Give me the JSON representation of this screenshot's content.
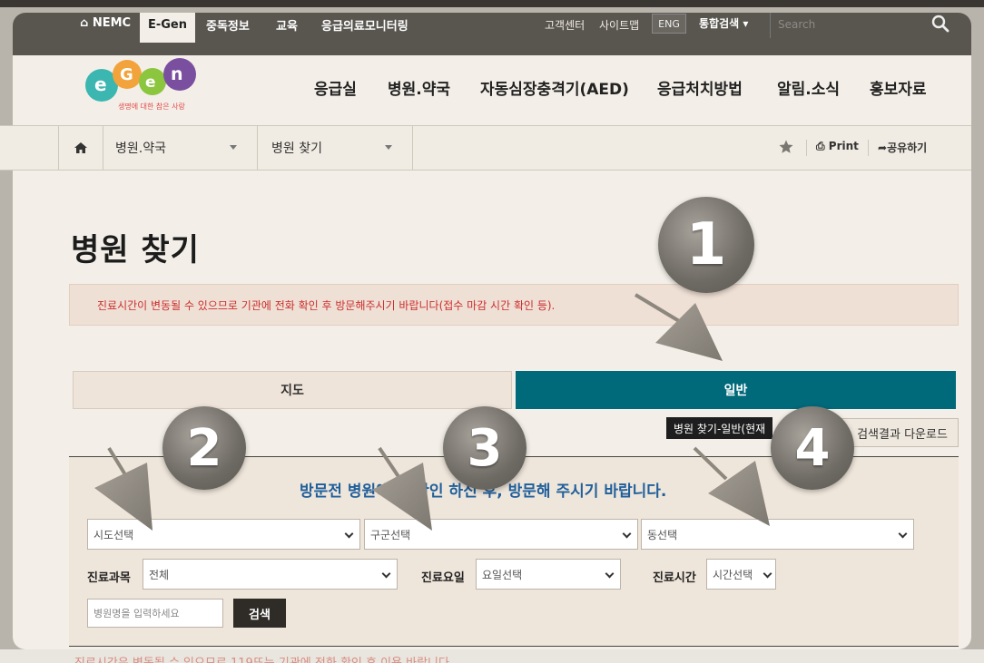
{
  "topbar": {
    "nemc": "NEMC",
    "egen": "E-Gen",
    "links": [
      "중독정보",
      "교육",
      "응급의료모니터링"
    ],
    "util_links": [
      "고객센터",
      "사이트맵"
    ],
    "eng": "ENG",
    "integrated_search": "통합검색",
    "search_placeholder": "Search"
  },
  "logo": {
    "subtitle": "생명에 대한 참은 사랑"
  },
  "mainnav": [
    "응급실",
    "병원.약국",
    "자동심장충격기(AED)",
    "응급처치방법",
    "알림.소식",
    "홍보자료"
  ],
  "breadcrumb": {
    "level1": "병원.약국",
    "level2": "병원 찾기",
    "print": "Print",
    "share": "공유하기"
  },
  "page": {
    "title": "병원 찾기",
    "notice": "진료시간이 변동될 수 있으므로 기관에 전화 확인 후 방문해주시기 바랍니다(접수 마감 시간 확인 등)."
  },
  "tabs": {
    "map": "지도",
    "general": "일반"
  },
  "tooltip": "병원 찾기-일반(현재",
  "download": "검색결과 다운로드",
  "search": {
    "title": "방문전 병원에 보 확인 하신 후, 방문해 주시기 바랍니다.",
    "sido": "시도선택",
    "gugun": "구군선택",
    "dong": "동선택",
    "dept_label": "진료과목",
    "dept_value": "전체",
    "day_label": "진료요일",
    "day_value": "요일선택",
    "time_label": "진료시간",
    "time_value": "시간선택",
    "name_placeholder": "병원명을 입력하세요",
    "submit": "검색"
  },
  "footer_notice": "진료시간은 변동될 수 있으므로 119또는 기관에 전화 확인 후 이용 바랍니다.",
  "annotations": [
    "1",
    "2",
    "3",
    "4"
  ]
}
